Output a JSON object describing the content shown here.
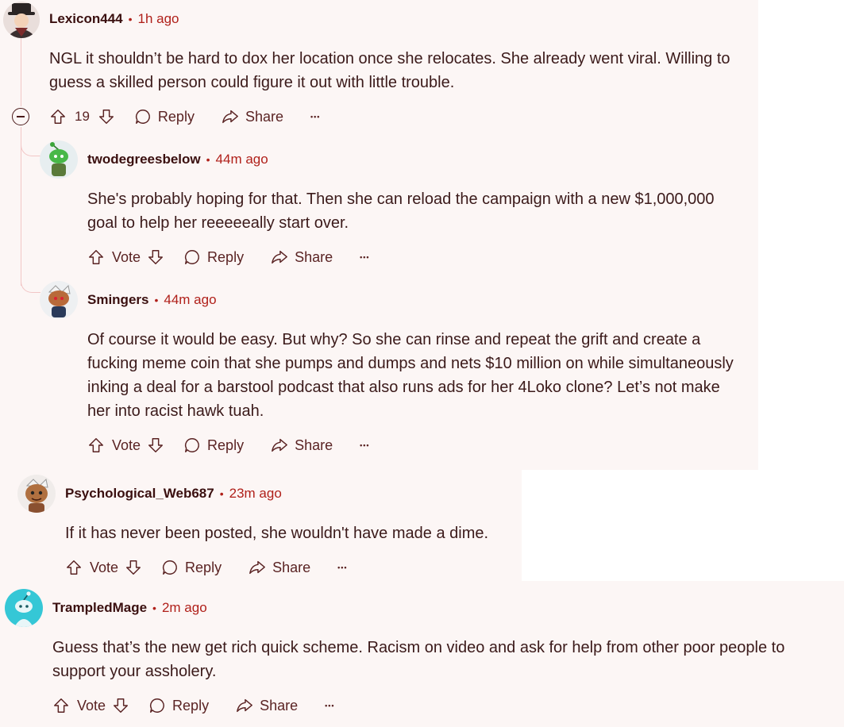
{
  "comments": [
    {
      "username": "Lexicon444",
      "time": "1h ago",
      "body": "NGL it shouldn’t be hard to dox her location once she relocates. She already went viral. Willing to guess a skilled person could figure it out with little trouble.",
      "votes": "19",
      "reply": "Reply",
      "share": "Share",
      "more": "•••"
    },
    {
      "username": "twodegreesbelow",
      "time": "44m ago",
      "body": "She's probably hoping for that. Then she can reload the campaign with a new $1,000,000 goal to help her reeeeeally start over.",
      "votes": "Vote",
      "reply": "Reply",
      "share": "Share",
      "more": "•••"
    },
    {
      "username": "Smingers",
      "time": "44m ago",
      "body": "Of course it would be easy. But why? So she can rinse and repeat the grift and create a fucking meme coin that she pumps and dumps and nets $10 million on while simultaneously inking a deal for a barstool podcast that also runs ads for her 4Loko clone? Let’s not make her into racist hawk tuah.",
      "votes": "Vote",
      "reply": "Reply",
      "share": "Share",
      "more": "•••"
    },
    {
      "username": "Psychological_Web687",
      "time": "23m ago",
      "body": "If it has never been posted, she wouldn't have made a dime.",
      "votes": "Vote",
      "reply": "Reply",
      "share": "Share",
      "more": "•••"
    },
    {
      "username": "TrampledMage",
      "time": "2m ago",
      "body": "Guess that’s the new get rich quick scheme. Racism on video and ask for help from other poor people to support your assholery.",
      "votes": "Vote",
      "reply": "Reply",
      "share": "Share",
      "more": "•••"
    }
  ],
  "separator": "•",
  "colors": {
    "background": "#fcf6f5",
    "username": "#3a0f0f",
    "timestamp": "#b0201a",
    "text": "#3b1a1a",
    "thread_line": "#f2c6c6"
  }
}
